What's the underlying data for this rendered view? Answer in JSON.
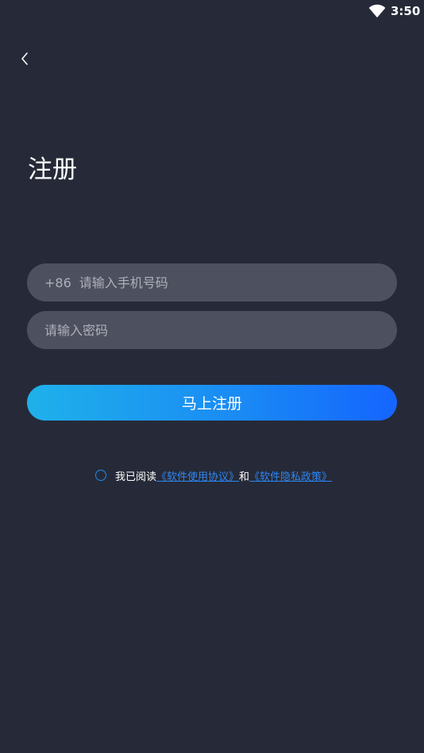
{
  "status_bar": {
    "time": "3:50",
    "wifi_icon": "wifi-icon"
  },
  "nav": {
    "back_icon": "chevron-left-icon"
  },
  "page": {
    "title": "注册"
  },
  "form": {
    "phone": {
      "prefix": "+86",
      "placeholder": "请输入手机号码",
      "value": ""
    },
    "password": {
      "placeholder": "请输入密码",
      "value": ""
    },
    "submit_label": "马上注册"
  },
  "agreement": {
    "prefix_text": "我已阅读",
    "terms_link": "《软件使用协议》",
    "conjunction": "和",
    "privacy_link": "《软件隐私政策》",
    "accent_color": "#2f86f2"
  },
  "colors": {
    "background": "#262a38",
    "field_background": "#4d505e",
    "button_gradient_start": "#1fb1ea",
    "button_gradient_end": "#1565fe"
  }
}
